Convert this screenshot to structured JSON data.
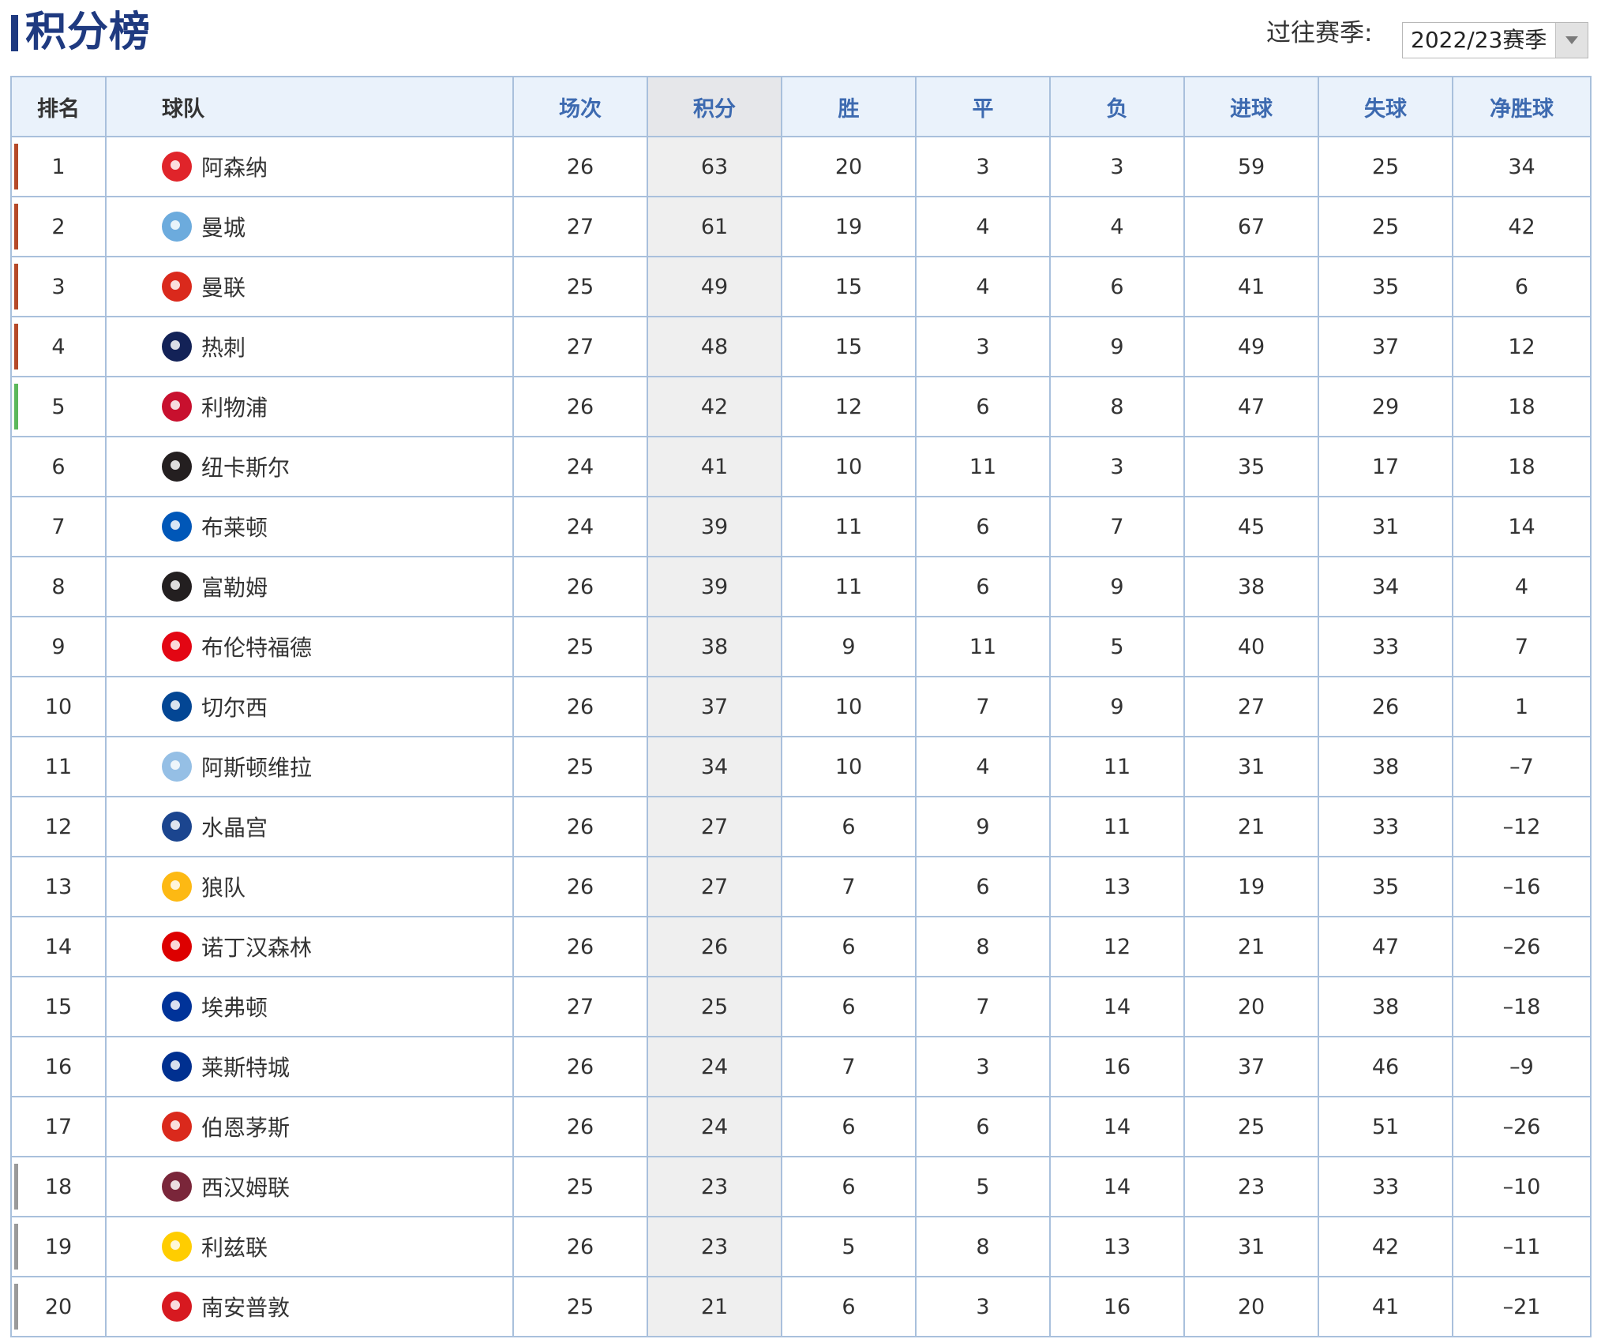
{
  "header": {
    "title": "积分榜",
    "season_label": "过往赛季:",
    "season_selected": "2022/23赛季"
  },
  "colors": {
    "accent": "#1f3a80",
    "header_text": "#3d6ab0",
    "border": "#a9c0dc",
    "zone_champions_league": "#b54a2a",
    "zone_europa_league": "#5cb85c",
    "zone_relegation": "#9a9a9a"
  },
  "columns": [
    "排名",
    "球队",
    "场次",
    "积分",
    "胜",
    "平",
    "负",
    "进球",
    "失球",
    "净胜球"
  ],
  "rows": [
    {
      "rank": "1",
      "team": "阿森纳",
      "logo": "arsenal-crest",
      "logo_color": "#e0242a",
      "played": "26",
      "points": "63",
      "won": "20",
      "drawn": "3",
      "lost": "3",
      "gf": "59",
      "ga": "25",
      "gd": "34",
      "zone": "champions_league"
    },
    {
      "rank": "2",
      "team": "曼城",
      "logo": "man-city-crest",
      "logo_color": "#6cabdd",
      "played": "27",
      "points": "61",
      "won": "19",
      "drawn": "4",
      "lost": "4",
      "gf": "67",
      "ga": "25",
      "gd": "42",
      "zone": "champions_league"
    },
    {
      "rank": "3",
      "team": "曼联",
      "logo": "man-united-crest",
      "logo_color": "#da291c",
      "played": "25",
      "points": "49",
      "won": "15",
      "drawn": "4",
      "lost": "6",
      "gf": "41",
      "ga": "35",
      "gd": "6",
      "zone": "champions_league"
    },
    {
      "rank": "4",
      "team": "热刺",
      "logo": "tottenham-crest",
      "logo_color": "#132257",
      "played": "27",
      "points": "48",
      "won": "15",
      "drawn": "3",
      "lost": "9",
      "gf": "49",
      "ga": "37",
      "gd": "12",
      "zone": "champions_league"
    },
    {
      "rank": "5",
      "team": "利物浦",
      "logo": "liverpool-crest",
      "logo_color": "#c8102e",
      "played": "26",
      "points": "42",
      "won": "12",
      "drawn": "6",
      "lost": "8",
      "gf": "47",
      "ga": "29",
      "gd": "18",
      "zone": "europa_league"
    },
    {
      "rank": "6",
      "team": "纽卡斯尔",
      "logo": "newcastle-crest",
      "logo_color": "#241f20",
      "played": "24",
      "points": "41",
      "won": "10",
      "drawn": "11",
      "lost": "3",
      "gf": "35",
      "ga": "17",
      "gd": "18",
      "zone": ""
    },
    {
      "rank": "7",
      "team": "布莱顿",
      "logo": "brighton-crest",
      "logo_color": "#0057b8",
      "played": "24",
      "points": "39",
      "won": "11",
      "drawn": "6",
      "lost": "7",
      "gf": "45",
      "ga": "31",
      "gd": "14",
      "zone": ""
    },
    {
      "rank": "8",
      "team": "富勒姆",
      "logo": "fulham-crest",
      "logo_color": "#231f20",
      "played": "26",
      "points": "39",
      "won": "11",
      "drawn": "6",
      "lost": "9",
      "gf": "38",
      "ga": "34",
      "gd": "4",
      "zone": ""
    },
    {
      "rank": "9",
      "team": "布伦特福德",
      "logo": "brentford-crest",
      "logo_color": "#e30613",
      "played": "25",
      "points": "38",
      "won": "9",
      "drawn": "11",
      "lost": "5",
      "gf": "40",
      "ga": "33",
      "gd": "7",
      "zone": ""
    },
    {
      "rank": "10",
      "team": "切尔西",
      "logo": "chelsea-crest",
      "logo_color": "#034694",
      "played": "26",
      "points": "37",
      "won": "10",
      "drawn": "7",
      "lost": "9",
      "gf": "27",
      "ga": "26",
      "gd": "1",
      "zone": ""
    },
    {
      "rank": "11",
      "team": "阿斯顿维拉",
      "logo": "aston-villa-crest",
      "logo_color": "#95bfe5",
      "played": "25",
      "points": "34",
      "won": "10",
      "drawn": "4",
      "lost": "11",
      "gf": "31",
      "ga": "38",
      "gd": "–7",
      "zone": ""
    },
    {
      "rank": "12",
      "team": "水晶宫",
      "logo": "crystal-palace-crest",
      "logo_color": "#1b458f",
      "played": "26",
      "points": "27",
      "won": "6",
      "drawn": "9",
      "lost": "11",
      "gf": "21",
      "ga": "33",
      "gd": "–12",
      "zone": ""
    },
    {
      "rank": "13",
      "team": "狼队",
      "logo": "wolves-crest",
      "logo_color": "#fdb913",
      "played": "26",
      "points": "27",
      "won": "7",
      "drawn": "6",
      "lost": "13",
      "gf": "19",
      "ga": "35",
      "gd": "–16",
      "zone": ""
    },
    {
      "rank": "14",
      "team": "诺丁汉森林",
      "logo": "nottingham-forest-crest",
      "logo_color": "#dd0000",
      "played": "26",
      "points": "26",
      "won": "6",
      "drawn": "8",
      "lost": "12",
      "gf": "21",
      "ga": "47",
      "gd": "–26",
      "zone": ""
    },
    {
      "rank": "15",
      "team": "埃弗顿",
      "logo": "everton-crest",
      "logo_color": "#003399",
      "played": "27",
      "points": "25",
      "won": "6",
      "drawn": "7",
      "lost": "14",
      "gf": "20",
      "ga": "38",
      "gd": "–18",
      "zone": ""
    },
    {
      "rank": "16",
      "team": "莱斯特城",
      "logo": "leicester-crest",
      "logo_color": "#003090",
      "played": "26",
      "points": "24",
      "won": "7",
      "drawn": "3",
      "lost": "16",
      "gf": "37",
      "ga": "46",
      "gd": "–9",
      "zone": ""
    },
    {
      "rank": "17",
      "team": "伯恩茅斯",
      "logo": "bournemouth-crest",
      "logo_color": "#da291c",
      "played": "26",
      "points": "24",
      "won": "6",
      "drawn": "6",
      "lost": "14",
      "gf": "25",
      "ga": "51",
      "gd": "–26",
      "zone": ""
    },
    {
      "rank": "18",
      "team": "西汉姆联",
      "logo": "west-ham-crest",
      "logo_color": "#7a263a",
      "played": "25",
      "points": "23",
      "won": "6",
      "drawn": "5",
      "lost": "14",
      "gf": "23",
      "ga": "33",
      "gd": "–10",
      "zone": "relegation"
    },
    {
      "rank": "19",
      "team": "利兹联",
      "logo": "leeds-crest",
      "logo_color": "#ffcd00",
      "played": "26",
      "points": "23",
      "won": "5",
      "drawn": "8",
      "lost": "13",
      "gf": "31",
      "ga": "42",
      "gd": "–11",
      "zone": "relegation"
    },
    {
      "rank": "20",
      "team": "南安普敦",
      "logo": "southampton-crest",
      "logo_color": "#d71920",
      "played": "25",
      "points": "21",
      "won": "6",
      "drawn": "3",
      "lost": "16",
      "gf": "20",
      "ga": "41",
      "gd": "–21",
      "zone": "relegation"
    }
  ]
}
